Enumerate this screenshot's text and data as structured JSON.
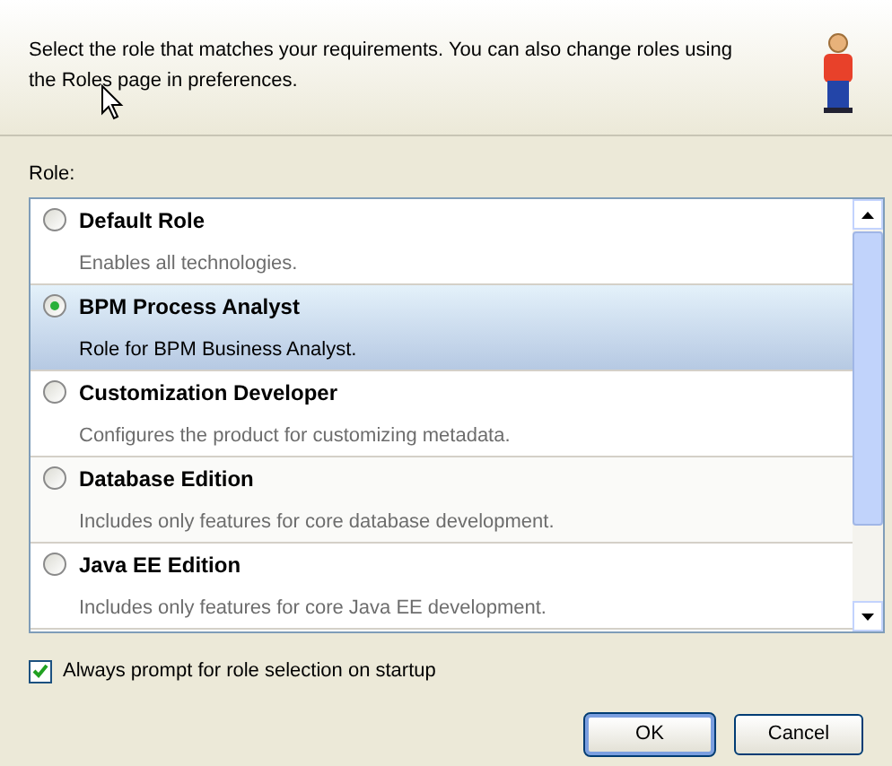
{
  "header": {
    "text": "Select the role that matches your requirements. You can also change roles using the Roles page in preferences."
  },
  "role_label": "Role:",
  "roles": [
    {
      "name": "Default Role",
      "description": "Enables all technologies.",
      "selected": false
    },
    {
      "name": "BPM Process Analyst",
      "description": "Role for BPM Business Analyst.",
      "selected": true
    },
    {
      "name": "Customization Developer",
      "description": "Configures the product for customizing metadata.",
      "selected": false
    },
    {
      "name": "Database Edition",
      "description": "Includes only features for core database development.",
      "selected": false
    },
    {
      "name": "Java EE Edition",
      "description": "Includes only features for core Java EE development.",
      "selected": false
    }
  ],
  "prompt_checkbox": {
    "label": "Always prompt for role selection on startup",
    "checked": true
  },
  "buttons": [
    {
      "label": "OK",
      "default": true
    },
    {
      "label": "Cancel",
      "default": false
    }
  ]
}
